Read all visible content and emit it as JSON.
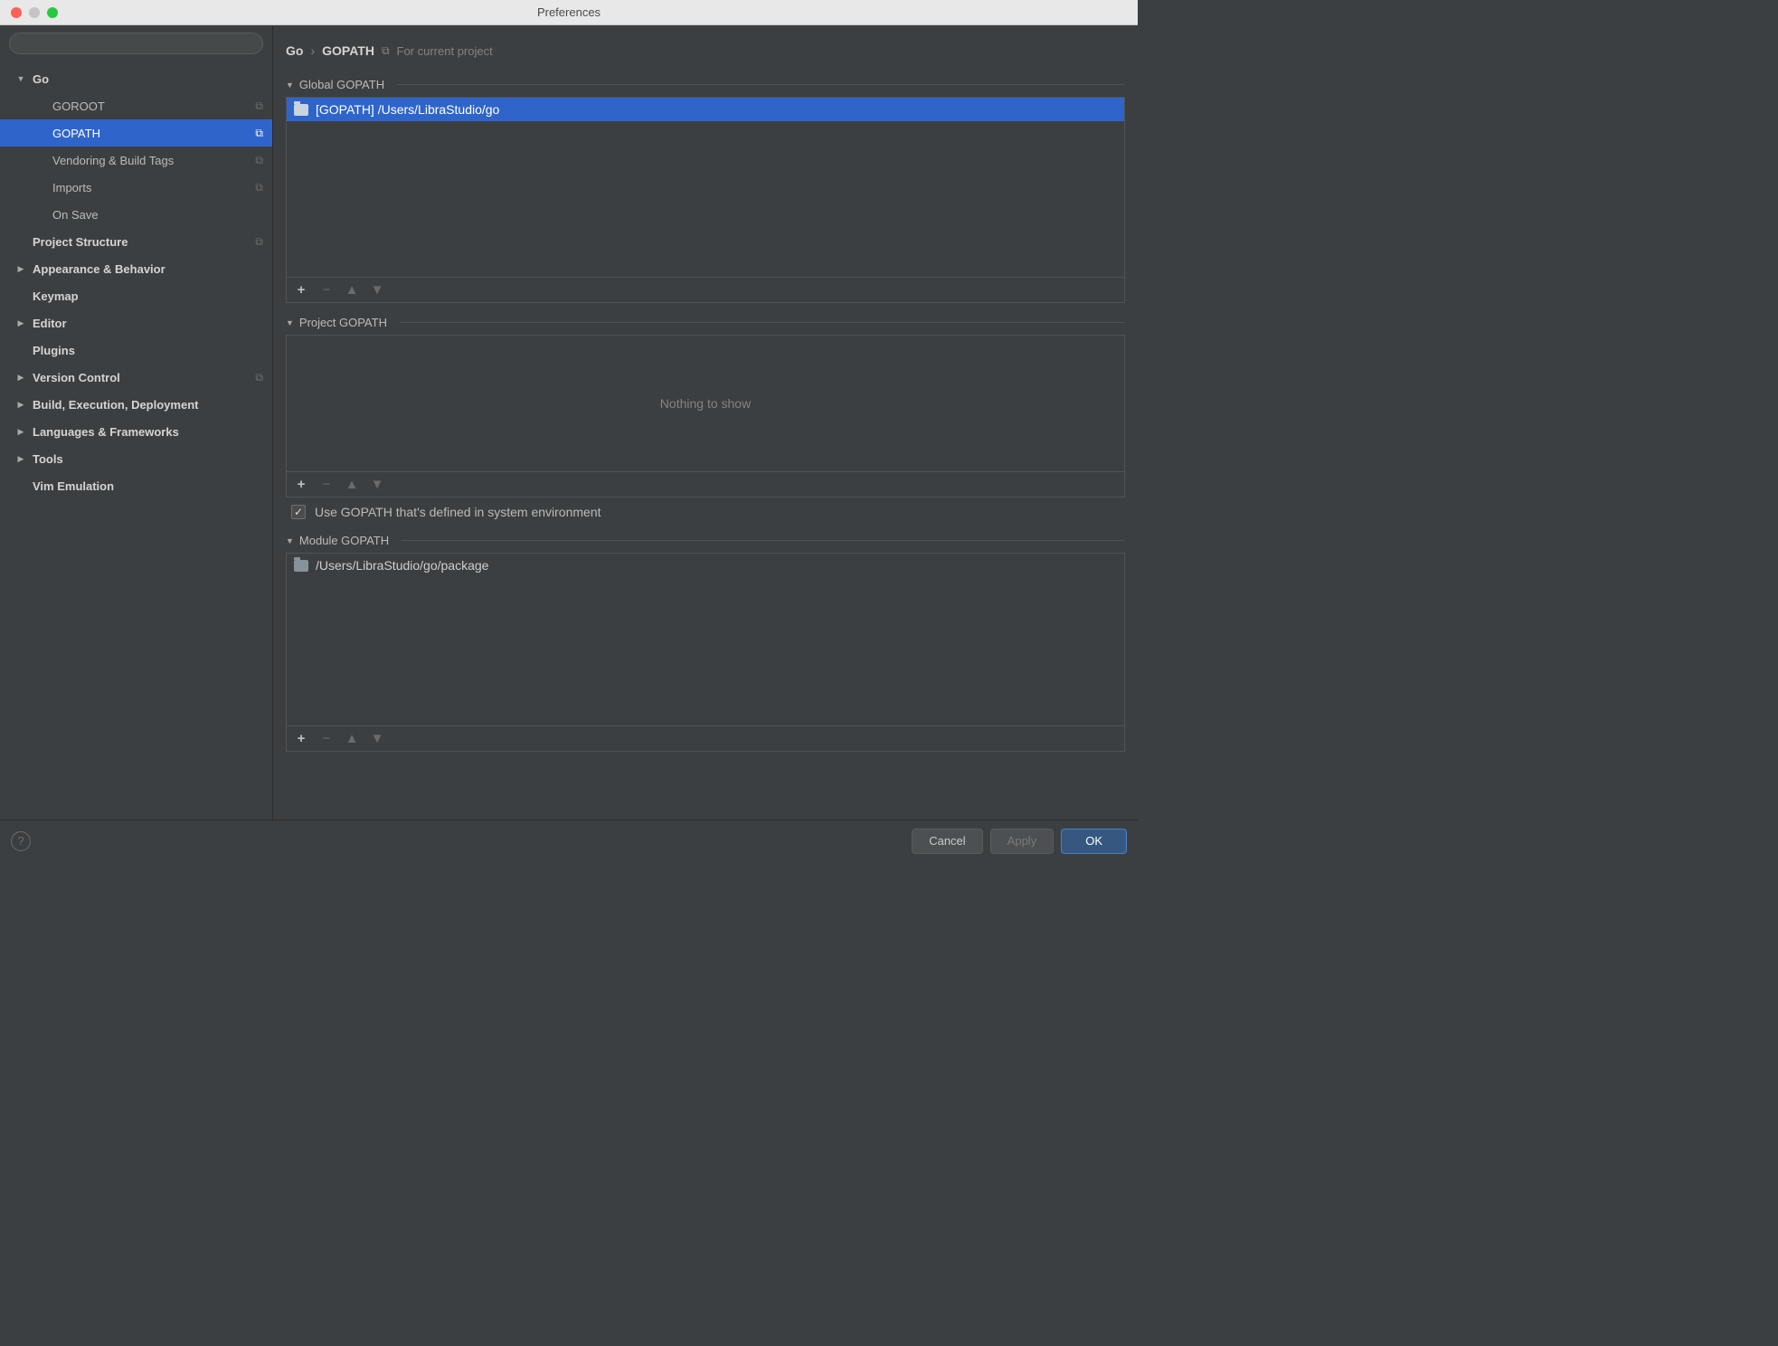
{
  "title": "Preferences",
  "search": {
    "placeholder": ""
  },
  "sidebar": {
    "items": [
      {
        "label": "Go",
        "bold": true,
        "expanded": true,
        "hasChildren": true,
        "hasCopy": false
      },
      {
        "label": "GOROOT",
        "level": 1,
        "hasCopy": true
      },
      {
        "label": "GOPATH",
        "level": 1,
        "hasCopy": true,
        "selected": true
      },
      {
        "label": "Vendoring & Build Tags",
        "level": 1,
        "hasCopy": true
      },
      {
        "label": "Imports",
        "level": 1,
        "hasCopy": true
      },
      {
        "label": "On Save",
        "level": 1
      },
      {
        "label": "Project Structure",
        "bold": true,
        "hasCopy": true
      },
      {
        "label": "Appearance & Behavior",
        "bold": true,
        "hasChildren": true
      },
      {
        "label": "Keymap",
        "bold": true
      },
      {
        "label": "Editor",
        "bold": true,
        "hasChildren": true
      },
      {
        "label": "Plugins",
        "bold": true
      },
      {
        "label": "Version Control",
        "bold": true,
        "hasChildren": true,
        "hasCopy": true
      },
      {
        "label": "Build, Execution, Deployment",
        "bold": true,
        "hasChildren": true
      },
      {
        "label": "Languages & Frameworks",
        "bold": true,
        "hasChildren": true
      },
      {
        "label": "Tools",
        "bold": true,
        "hasChildren": true
      },
      {
        "label": "Vim Emulation",
        "bold": true
      }
    ]
  },
  "breadcrumb": {
    "parent": "Go",
    "current": "GOPATH",
    "scope": "For current project"
  },
  "sections": {
    "global": {
      "title": "Global GOPATH",
      "items": [
        {
          "text": "[GOPATH] /Users/LibraStudio/go",
          "selected": true
        }
      ]
    },
    "project": {
      "title": "Project GOPATH",
      "empty": "Nothing to show"
    },
    "useSystem": {
      "label": "Use GOPATH that's defined in system environment",
      "checked": true
    },
    "module": {
      "title": "Module GOPATH",
      "items": [
        {
          "text": "/Users/LibraStudio/go/package"
        }
      ]
    }
  },
  "footer": {
    "cancel": "Cancel",
    "apply": "Apply",
    "ok": "OK"
  }
}
